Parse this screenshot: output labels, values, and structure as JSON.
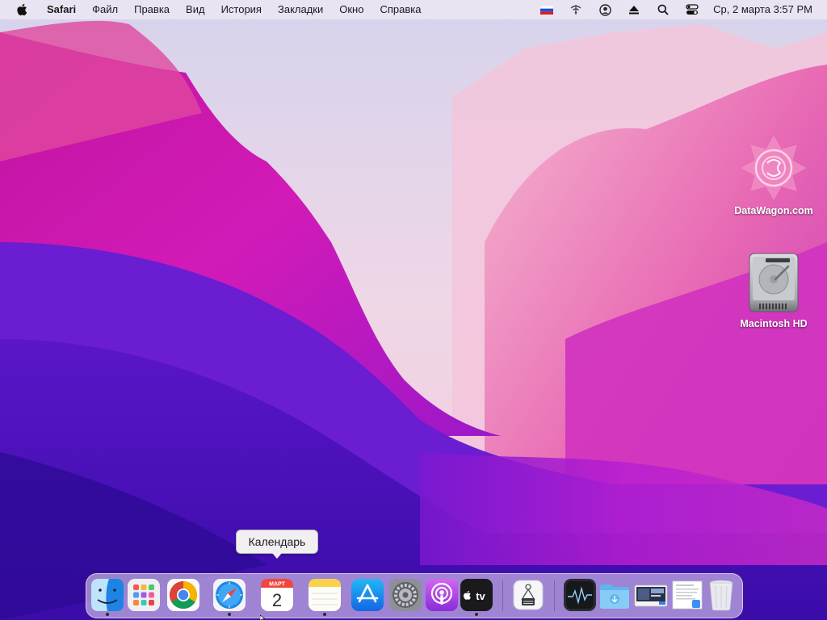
{
  "menubar": {
    "apple_icon": "apple-logo-icon",
    "app_name": "Safari",
    "menus": [
      "Файл",
      "Правка",
      "Вид",
      "История",
      "Закладки",
      "Окно",
      "Справка"
    ],
    "status_icons": [
      "russian-flag-input-icon",
      "wifi-off-icon",
      "user-account-icon",
      "eject-icon",
      "spotlight-search-icon",
      "control-center-icon"
    ],
    "clock": "Ср, 2 марта  3:57 PM"
  },
  "desktop": {
    "icons": [
      {
        "label": "DataWagon.com",
        "icon": "datawagon-logo-icon"
      },
      {
        "label": "Macintosh HD",
        "icon": "hard-drive-icon"
      }
    ]
  },
  "tooltip": {
    "text": "Календарь"
  },
  "dock": {
    "apps": [
      {
        "name": "Finder",
        "icon": "finder-icon",
        "running": true
      },
      {
        "name": "Launchpad",
        "icon": "launchpad-icon",
        "running": false
      },
      {
        "name": "Google Chrome",
        "icon": "chrome-icon",
        "running": false
      },
      {
        "name": "Safari",
        "icon": "safari-icon",
        "running": true
      },
      {
        "name": "Календарь",
        "icon": "calendar-icon",
        "running": false,
        "month": "МАРТ",
        "day": "2"
      },
      {
        "name": "Заметки",
        "icon": "notes-icon",
        "running": true
      },
      {
        "name": "App Store",
        "icon": "app-store-icon",
        "running": false
      },
      {
        "name": "Системные настройки",
        "icon": "system-preferences-icon",
        "running": false
      },
      {
        "name": "Подкасты",
        "icon": "podcasts-icon",
        "running": false
      },
      {
        "name": "TV",
        "icon": "apple-tv-icon",
        "running": true,
        "label": "tv"
      },
      {
        "name": "Image Capture",
        "icon": "image-capture-icon",
        "running": false
      },
      {
        "name": "Activity Monitor",
        "icon": "activity-monitor-icon",
        "running": false
      },
      {
        "name": "Downloads",
        "icon": "downloads-folder-icon",
        "running": false
      },
      {
        "name": "Screenshot",
        "icon": "screenshot-thumbnail-icon",
        "running": false
      },
      {
        "name": "Document",
        "icon": "document-thumbnail-icon",
        "running": false
      },
      {
        "name": "Trash",
        "icon": "trash-icon",
        "running": false
      }
    ]
  },
  "colors": {
    "menubar_bg": "#ece8f2",
    "wallpaper_top": "#d8d3ea",
    "wallpaper_magenta": "#c21fbf",
    "wallpaper_purple": "#4a12c0"
  }
}
